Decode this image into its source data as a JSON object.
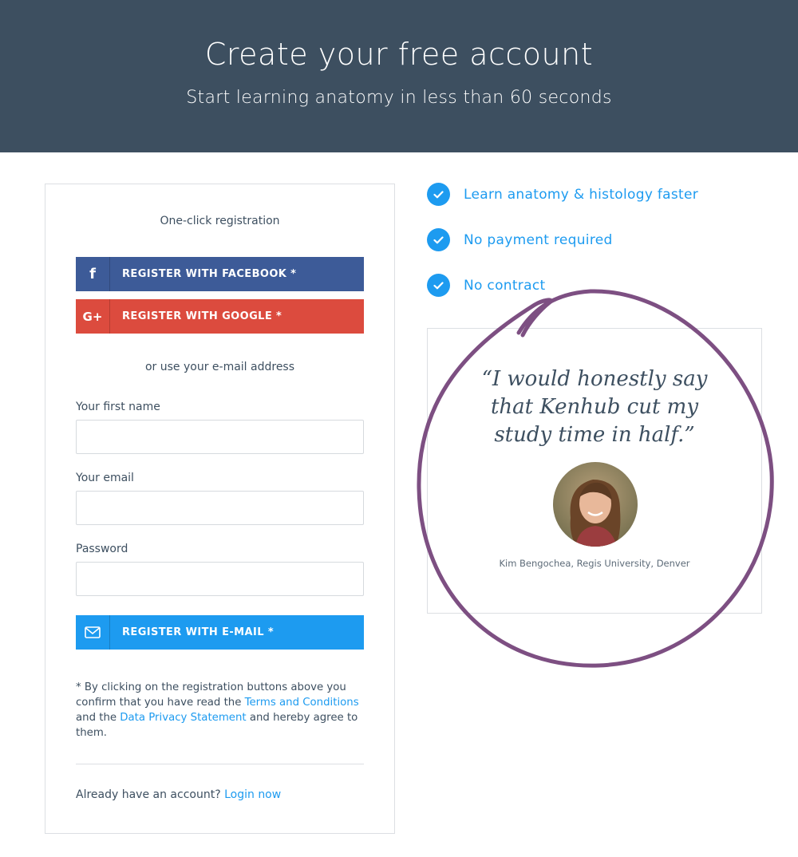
{
  "header": {
    "title": "Create your free account",
    "subtitle": "Start learning anatomy in less than 60 seconds"
  },
  "form": {
    "oneclick_label": "One-click registration",
    "facebook_button": {
      "label": "REGISTER WITH FACEBOOK *",
      "icon": "facebook-icon",
      "glyph": "f"
    },
    "google_button": {
      "label": "REGISTER WITH GOOGLE *",
      "icon": "google-plus-icon",
      "glyph": "G+"
    },
    "or_label": "or use your e-mail address",
    "first_name": {
      "label": "Your first name",
      "value": "",
      "placeholder": ""
    },
    "email": {
      "label": "Your email",
      "value": "",
      "placeholder": ""
    },
    "password": {
      "label": "Password",
      "value": "",
      "placeholder": ""
    },
    "email_button": {
      "label": "REGISTER WITH E-MAIL *",
      "icon": "envelope-icon"
    },
    "legal": {
      "prefix": "* By clicking on the registration buttons above you confirm that you have read the ",
      "terms_link": "Terms and Conditions",
      "middle": " and the ",
      "privacy_link": "Data Privacy Statement",
      "suffix": " and hereby agree to them."
    },
    "login": {
      "prompt": "Already have an account?",
      "link": "Login now"
    }
  },
  "features": [
    {
      "label": "Learn anatomy & histology faster",
      "icon": "checkmark-icon"
    },
    {
      "label": "No payment required",
      "icon": "checkmark-icon"
    },
    {
      "label": "No contract",
      "icon": "checkmark-icon"
    }
  ],
  "testimonial": {
    "quote": "“I would honestly say that Kenhub cut my study time in half.”",
    "attribution": "Kim Bengochea, Regis University, Denver"
  },
  "colors": {
    "header_bg": "#3d4f60",
    "accent": "#1d9bf0",
    "facebook": "#3d5b98",
    "google": "#dc4b3e",
    "annotation_circle": "#7d4f82"
  }
}
